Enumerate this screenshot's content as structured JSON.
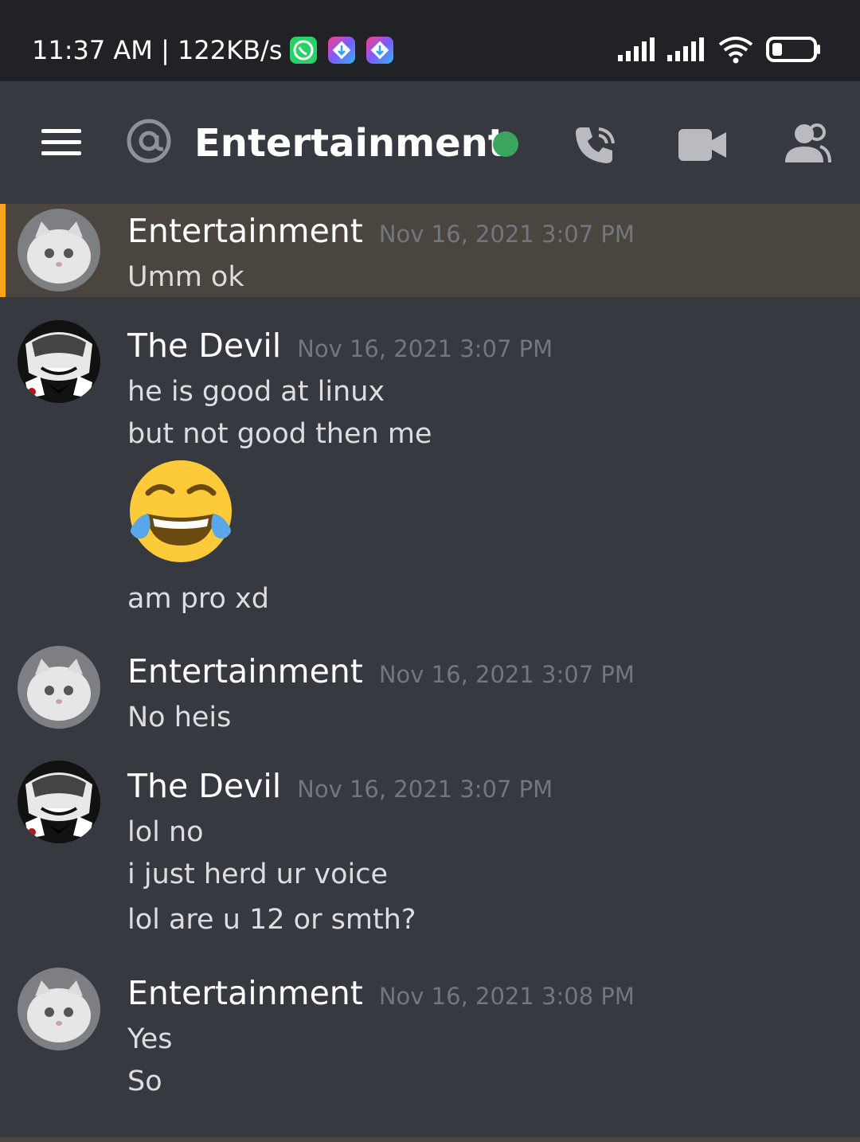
{
  "status_bar": {
    "time_speed": "11:37 AM | 122KB/s",
    "icons": [
      "whatsapp-icon",
      "app-icon",
      "app-icon",
      "signal-icon",
      "signal-icon",
      "wifi-icon",
      "battery-icon"
    ]
  },
  "header": {
    "channel_name": "Entertainment",
    "icons": [
      "menu-icon",
      "at-icon",
      "online-status",
      "call-icon",
      "video-icon",
      "members-icon"
    ],
    "online_color": "#3ba55d"
  },
  "messages": [
    {
      "author": "Entertainment",
      "timestamp": "Nov 16, 2021 3:07 PM",
      "lines": [
        "Umm ok"
      ],
      "highlight": true
    },
    {
      "author": "The Devil",
      "timestamp": "Nov 16, 2021 3:07 PM",
      "lines": [
        "he is good at linux",
        "but not good then me",
        "😂",
        "am pro xd"
      ]
    },
    {
      "author": "Entertainment",
      "timestamp": "Nov 16, 2021 3:07 PM",
      "lines": [
        "No heis"
      ]
    },
    {
      "author": "The Devil",
      "timestamp": "Nov 16, 2021 3:07 PM",
      "lines": [
        "lol no",
        "i just herd ur voice",
        "lol are u 12 or smth?"
      ]
    },
    {
      "author": "Entertainment",
      "timestamp": "Nov 16, 2021 3:08 PM",
      "lines": [
        "Yes",
        "So"
      ]
    }
  ],
  "colors": {
    "background": "#36393f",
    "highlight_bg": "#4a463f",
    "highlight_bar": "#faa61a",
    "timestamp": "#72767d"
  }
}
